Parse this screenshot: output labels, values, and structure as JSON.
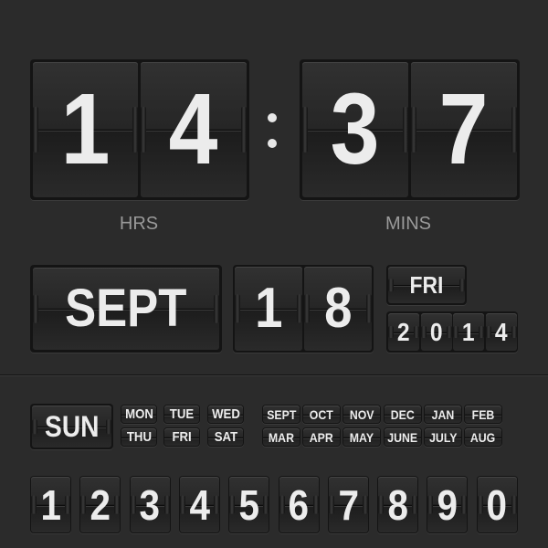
{
  "time": {
    "hours": [
      "1",
      "4"
    ],
    "minutes": [
      "3",
      "7"
    ],
    "hours_label": "HRS",
    "minutes_label": "MINS"
  },
  "date": {
    "month": "SEPT",
    "day": [
      "1",
      "8"
    ],
    "weekday": "FRI",
    "year": [
      "2",
      "0",
      "1",
      "4"
    ]
  },
  "palette": {
    "featured_day": "SUN",
    "days": [
      "MON",
      "TUE",
      "WED",
      "THU",
      "FRI",
      "SAT"
    ],
    "months": [
      "SEPT",
      "OCT",
      "NOV",
      "DEC",
      "JAN",
      "FEB",
      "MAR",
      "APR",
      "MAY",
      "JUNE",
      "JULY",
      "AUG"
    ],
    "digits": [
      "1",
      "2",
      "3",
      "4",
      "5",
      "6",
      "7",
      "8",
      "9",
      "0"
    ]
  },
  "colors": {
    "background": "#2b2b2b",
    "card": "#2a2a2a",
    "text": "#ececec",
    "label": "#9a9a9a"
  }
}
